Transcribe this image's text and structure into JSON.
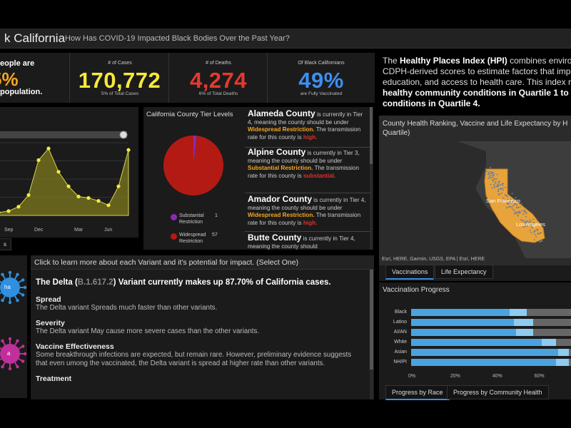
{
  "header": {
    "title": "k California",
    "subtitle": "How Has COVID-19 Impacted Black Bodies Over the Past Year?"
  },
  "stats": {
    "people_line1": "eople are",
    "people_value": "5%",
    "people_line2": "population.",
    "cases_label": "# of Cases",
    "cases_value": "170,772",
    "cases_sub": "5% of Total Cases",
    "deaths_label": "# of Deaths",
    "deaths_value": "4,274",
    "deaths_sub": "6% of Total Deaths",
    "vacc_label": "Of Black Californians",
    "vacc_value": "49%",
    "vacc_sub": "are Fully Vaccinated"
  },
  "hpi": {
    "prefix": "The ",
    "bold_name": "Healthy Places Index (HPI)",
    "rest1": " combines environm",
    "line2": "CDPH-derived scores to estimate factors that impa",
    "line3": "education, and access to health care. This index ra",
    "line4": "healthy community conditions in Quartile 1 to mo",
    "line5": "conditions in Quartile 4."
  },
  "colors": {
    "cases": "#f7e93b",
    "deaths": "#e53a2f",
    "vaccinated": "#3d8ef0",
    "pie_widespread": "#b41a14",
    "pie_substantial": "#8a2bb5",
    "bar_blue": "#4aa3df",
    "bar_light": "#8ecbf0",
    "bar_gray": "#666666"
  },
  "trend_chart": {
    "chart_data": {
      "type": "area",
      "x_ticks": [
        "Sep",
        "Dec",
        "Mar",
        "Jun"
      ],
      "values": [
        2,
        3,
        6,
        14,
        38,
        46,
        30,
        20,
        13,
        12,
        10,
        7,
        20,
        45
      ],
      "ylim": [
        0,
        50
      ]
    }
  },
  "tier_panel": {
    "title": "California County Tier Levels",
    "chart_data": {
      "type": "pie",
      "slices": [
        {
          "label": "Substantial Restriction",
          "value": 1
        },
        {
          "label": "Widespread Restriction",
          "value": 57
        }
      ]
    },
    "legend": [
      {
        "label_line1": "Substantial",
        "label_line2": "Restriction",
        "count": "1"
      },
      {
        "label_line1": "Widespread",
        "label_line2": "Restriction",
        "count": "57"
      }
    ]
  },
  "counties": [
    {
      "name": "Alameda County",
      "t1": " is currently in Tier 4, meaning the county should be under ",
      "restriction": "Widespread Restriction.",
      "t2": " The transmission rate for this county is ",
      "rate": "high."
    },
    {
      "name": "Alpine County",
      "t1": " is currently in Tier 3, meaning the county should be under ",
      "restriction": "Substantial Restriction.",
      "t2": " The transmission rate for this county is ",
      "rate": "substantial."
    },
    {
      "name": "Amador County",
      "t1": " is currently in Tier 4, meaning the county should be under ",
      "restriction": "Widespread Restriction.",
      "t2": " The transmission rate for this county is ",
      "rate": "high."
    },
    {
      "name": "Butte County",
      "t1": " is currently in Tier 4, meaning the county should",
      "restriction": "",
      "t2": "",
      "rate": ""
    }
  ],
  "variant": {
    "header": "Click to learn more about each Variant and it's potential for impact. (Select One)",
    "headline_a": "The Delta (",
    "headline_code": "B.1.617.2",
    "headline_b": ") Variant currently makes up 87.70% of California cases.",
    "spread_title": "Spread",
    "spread_text": "The Delta variant Spreads much faster than other variants.",
    "severity_title": "Severity",
    "severity_text": "The Delta variant May cause more severe cases than the other variants.",
    "vaccine_title": "Vaccine Effectiveness",
    "vaccine_text": "Some breakthrough infections are expected, but remain rare. However, preliminary evidence suggests that even umong the vaccinated, the Delta variant is spread at higher rate than other variants.",
    "treatment_title": "Treatment",
    "virus1_label": "ha",
    "virus2_label": "a"
  },
  "map_panel": {
    "title_line1": "County Health Ranking, Vaccine and Life Expectancy by H",
    "title_line2": "Quartile)",
    "city1": "San Francisco",
    "city2": "Los Angeles",
    "attribution": "Esri, HERE, Garmin, USGS, EPA | Esri, HERE",
    "tabs": [
      "Vaccinations",
      "Life Expectancy"
    ]
  },
  "vacc_progress": {
    "title": "Vaccination Progress",
    "chart_data": {
      "type": "bar",
      "orientation": "horizontal",
      "stacked": true,
      "categories": [
        "Black",
        "Latino",
        "AI/AN",
        "White",
        "Asian",
        "NH/PI"
      ],
      "series": [
        {
          "values": [
            47,
            49,
            50,
            62,
            70,
            69
          ]
        },
        {
          "values": [
            8,
            9,
            8,
            7,
            5,
            6
          ]
        }
      ],
      "x_ticks": [
        "0%",
        "20%",
        "40%",
        "60%"
      ],
      "xlim": [
        0,
        70
      ]
    },
    "tabs": [
      "Progress by Race",
      "Progress by Community Health"
    ]
  },
  "misc": {
    "small_tab": "s"
  }
}
